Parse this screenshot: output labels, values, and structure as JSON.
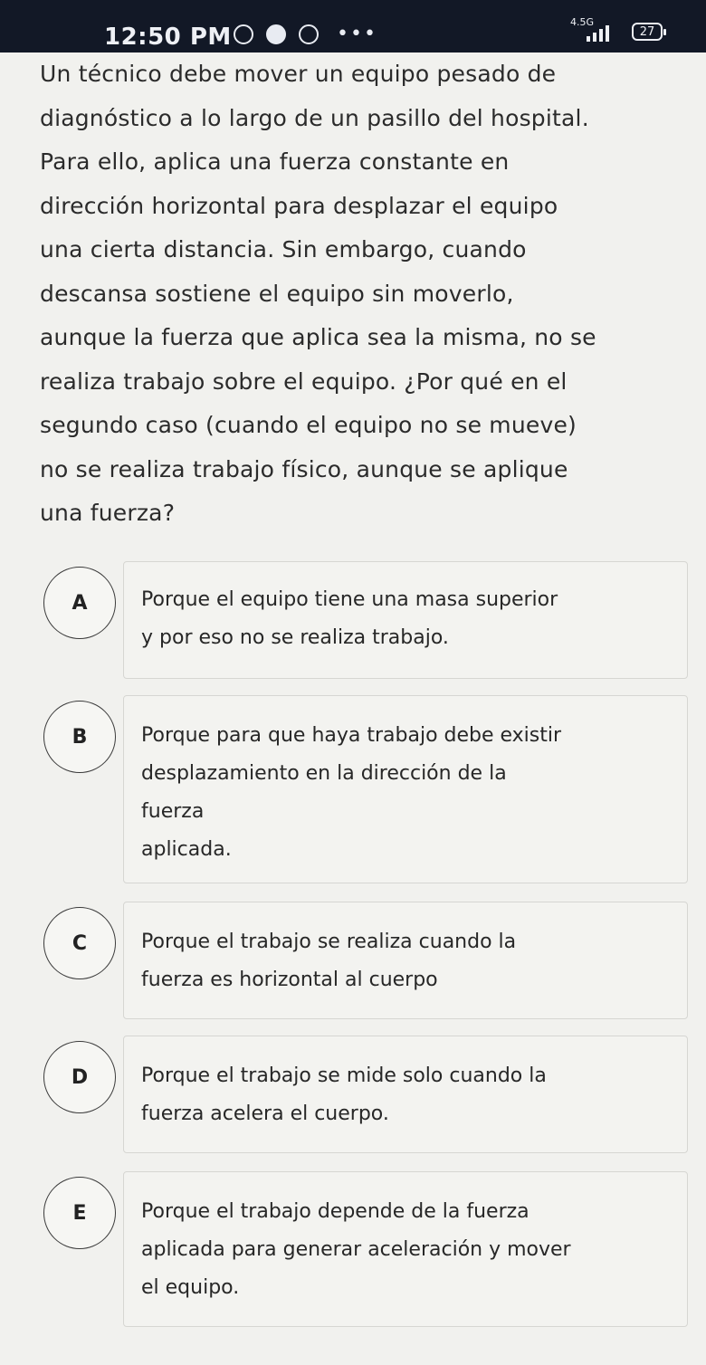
{
  "status_bar": {
    "time": "12:50 PM",
    "network": "4.5G",
    "battery": "27",
    "icons": [
      "whatsapp-icon",
      "messenger-icon",
      "notification-icon",
      "more-dots-icon",
      "signal-icon",
      "battery-icon"
    ]
  },
  "question": {
    "lines": [
      "Un técnico debe mover un  equipo pesado de",
      "diagnóstico a lo largo de un pasillo del hospital.",
      "Para ello, aplica una fuerza constante en",
      "dirección horizontal para desplazar el equipo",
      "una cierta distancia. Sin embargo, cuando",
      "descansa sostiene el equipo sin moverlo,",
      "aunque la fuerza que aplica sea la misma, no se",
      "realiza trabajo sobre el equipo. ¿Por qué en el",
      "segundo caso (cuando el equipo no se mueve)",
      "no se realiza trabajo físico, aunque se aplique",
      "una fuerza?"
    ]
  },
  "options": [
    {
      "letter": "A",
      "lines": [
        "Porque  el equipo tiene una masa superior",
        "y por eso no se realiza trabajo."
      ]
    },
    {
      "letter": "B",
      "lines": [
        "Porque  para que haya trabajo debe existir",
        "desplazamiento en la dirección de la",
        "fuerza",
        "aplicada."
      ]
    },
    {
      "letter": "C",
      "lines": [
        "Porque el trabajo se realiza cuando la",
        "fuerza es horizontal al cuerpo"
      ]
    },
    {
      "letter": "D",
      "lines": [
        "Porque el trabajo se mide solo cuando la",
        "fuerza acelera el cuerpo."
      ]
    },
    {
      "letter": "E",
      "lines": [
        "Porque  el trabajo depende de la fuerza",
        "aplicada para generar aceleración y mover",
        "el equipo."
      ]
    }
  ]
}
